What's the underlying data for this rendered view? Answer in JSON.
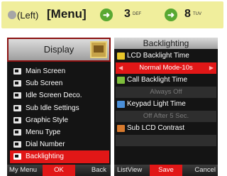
{
  "banner": {
    "left_soft_label": "(Left)",
    "menu_label": "[Menu]",
    "step1_arrow": "➜",
    "step1_key": "3",
    "step1_key_letters": "DEF",
    "step2_arrow": "➜",
    "step2_key": "8",
    "step2_key_letters": "TUV",
    "colors": {
      "background": "#f0ee9c",
      "arrow": "#58a832",
      "dot": "#a6a6a6"
    }
  },
  "display_screen": {
    "title": "Display",
    "items": [
      {
        "label": "Main Screen",
        "icon": "screen-icon"
      },
      {
        "label": "Sub Screen",
        "icon": "screen-icon"
      },
      {
        "label": "Idle Screen Deco.",
        "icon": "screen-icon"
      },
      {
        "label": "Sub Idle Settings",
        "icon": "screen-icon"
      },
      {
        "label": "Graphic Style",
        "icon": "screen-icon"
      },
      {
        "label": "Menu Type",
        "icon": "screen-icon"
      },
      {
        "label": "Dial Number",
        "icon": "phone-icon"
      },
      {
        "label": "Backlighting",
        "icon": "screen-icon",
        "selected": true
      }
    ],
    "softkeys": {
      "left": "My Menu",
      "center": "OK",
      "right": "Back"
    }
  },
  "backlighting_screen": {
    "title": "Backlighting",
    "settings": [
      {
        "label": "LCD Backlight Time",
        "value": "Normal Mode-10s",
        "active": true,
        "icon": "bulb-icon"
      },
      {
        "label": "Call Backlight Time",
        "value": "Always Off",
        "active": false,
        "icon": "call-icon"
      },
      {
        "label": "Keypad Light Time",
        "value": "Off After 5 Sec.",
        "active": false,
        "icon": "keypad-icon"
      },
      {
        "label": "Sub LCD Contrast",
        "value": "",
        "active": false,
        "icon": "contrast-icon"
      }
    ],
    "softkeys": {
      "left": "ListView",
      "center": "Save",
      "right": "Cancel"
    }
  },
  "colors": {
    "highlight": "#e11717",
    "screen_bg": "#141414"
  }
}
